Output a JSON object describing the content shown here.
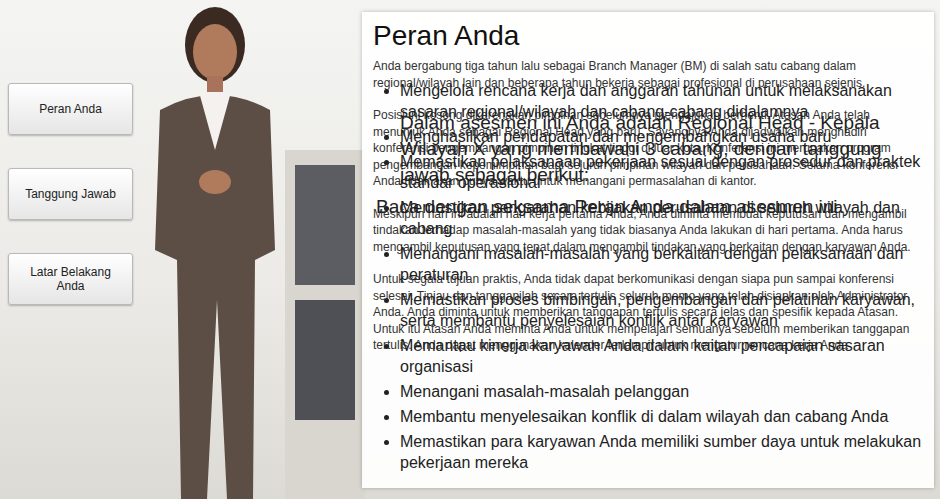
{
  "sidebar": {
    "items": [
      {
        "label": "Peran Anda"
      },
      {
        "label": "Tanggung Jawab"
      },
      {
        "label": "Latar Belakang Anda"
      }
    ]
  },
  "panel": {
    "title": "Peran Anda",
    "paragraphs": [
      "Anda bergabung tiga tahun lalu sebagai Branch Manager (BM) di salah satu cabang dalam regional/wilayah lain dan beberapa tahun bekerja sebagai profesional di perusahaan sejenis.",
      "Posisi ini kosong dikarenakan pimpinan sebelumnya mengajukan berhenti. Atasan Anda telah menunjuk Anda sebagai Regional Head yang baru. Sayangnya Anda dijadwalkan menghadiri konferensi pengembangan pimpinan tingkat tinggi di luar kota. Konferensi ini merupakan program pengembangan kepemimpinan bagi seluruh pimpinan wilayah dan perusahaan. Selama konferensi Anda tidak akan punya waktu untuk menangani permasalahan di kantor.",
      "Meskipun hari ini adalah hari kerja pertama Anda, Anda diminta membuat keputusan dan mengambil tindakan terhadap masalah-masalah yang tidak biasanya Anda lakukan di hari pertama. Anda harus mengambil keputusan yang tepat dalam mengambil tindakan yang berkaitan dengan karyawan Anda.",
      "Untuk segala tujuan praktis, Anda tidak dapat berkomunikasi dengan siapa pun sampai konferensi selesai. Tinjau dan tanggapilah secara tertulis seluruh memo yang telah disiapkan oleh Administrator Anda. Anda diminta untuk memberikan tanggapan tertulis secara jelas dan spesifik kepada Atasan. Untuk itu Atasan Anda meminta Anda untuk mempelajari semuanya sebelum memberikan tanggapan tertulis. Anda dapat menggunakan kalender terlampir untuk mengatur rencana kerja Anda"
    ],
    "intro": "Dalam asesmen ini Anda adalah Regional Head - Kepala Wilayah X yang membawahi 3 cabang, dengan tanggung jawab sebagai berikut:",
    "instruction": "Baca dengan seksama Peran Anda dalam asesmen ini",
    "bullets": [
      "Mengelola rencana kerja dan anggaran tahunan untuk melaksanakan sasaran regional/wilayah dan cabang-cabang didalamnya",
      "Menghasilkan pendapatan dan mengembangkan usaha baru",
      "Memastikan pelaksanaan pekerjaan sesuai dengan prosedur dan praktek standar operasional",
      "Memastikan pengarahan kebijakan perusahaan di seluruh wilayah dan cabang",
      "Menangani masalah-masalah yang berkaitan dengan pelaksanaan dan peraturan",
      "Memastikan proses bimbingan, pengembangan dan pelatihan karyawan, serta membantu penyelesaian konflik antar karyawan",
      "Memantau kinerja karyawan Anda dalam kaitan pencapaian sasaran organisasi",
      "Menangani masalah-masalah pelanggan",
      "Membantu menyelesaikan konflik di dalam wilayah dan cabang Anda",
      "Memastikan para karyawan Anda memiliki sumber daya untuk melakukan pekerjaan mereka"
    ]
  }
}
